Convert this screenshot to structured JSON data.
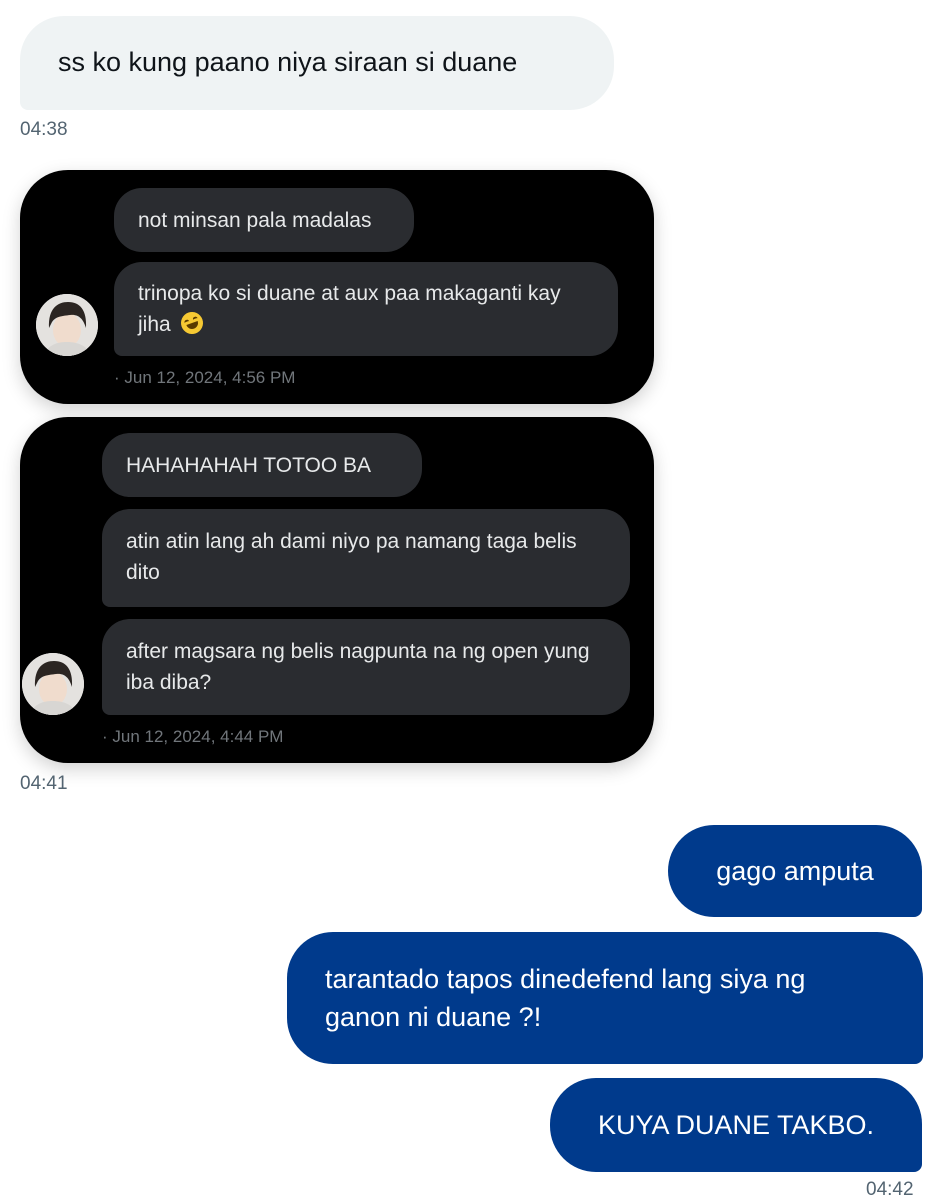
{
  "messages": {
    "m1": {
      "text": "ss ko kung paano niya siraan si duane",
      "time": "04:38"
    },
    "m2": {
      "time": "04:41"
    },
    "m3": {
      "text": "gago amputa"
    },
    "m4": {
      "text": "tarantado tapos dinedefend lang siya ng ganon ni duane ?!"
    },
    "m5": {
      "text": "KUYA DUANE TAKBO.",
      "time": "04:42"
    }
  },
  "screenshot1": {
    "bubbles": [
      "not minsan pala madalas",
      "trinopa ko si duane at aux paa makaganti kay jiha"
    ],
    "emoji": "rolling-on-floor-laughing",
    "timestamp": "· Jun 12, 2024, 4:56 PM"
  },
  "screenshot2": {
    "bubbles": [
      "HAHAHAHAH TOTOO BA",
      "atin atin lang ah dami niyo pa namang taga belis dito",
      "after magsara ng belis nagpunta na ng open yung iba diba?"
    ],
    "timestamp": "· Jun 12, 2024, 4:44 PM"
  },
  "colors": {
    "incoming_bubble": "#eff3f4",
    "outgoing_bubble": "#003a8c",
    "screenshot_bg": "#000000",
    "screenshot_bubble": "#2a2c30"
  }
}
